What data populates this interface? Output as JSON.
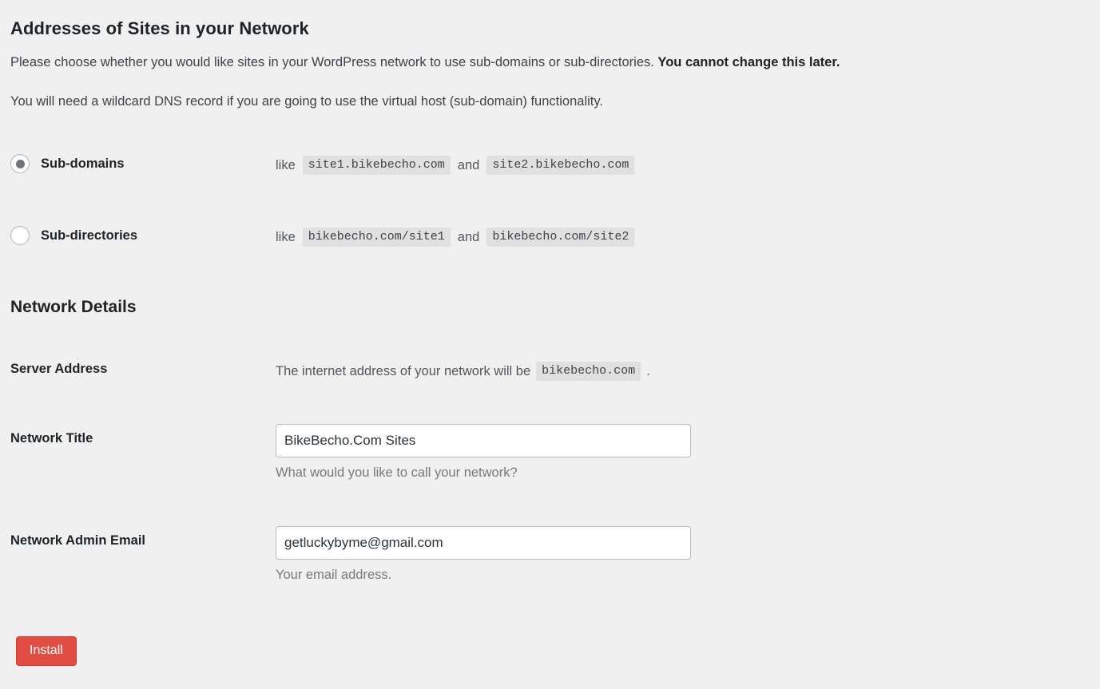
{
  "page": {
    "background_color": "#f0f0f1",
    "heading": "Addresses of Sites in your Network",
    "intro_paragraph_1_start": "Please choose whether you would like sites in your WordPress network to use sub-domains or sub-directories. ",
    "intro_paragraph_1_bold": "You cannot change this later.",
    "intro_paragraph_2": "You will need a wildcard DNS record if you are going to use the virtual host (sub-domain) functionality."
  },
  "address_options": {
    "like_label": "like",
    "and_label": "and",
    "options": [
      {
        "label": "Sub-domains",
        "selected": true,
        "example_1": "site1.bikebecho.com",
        "example_2": "site2.bikebecho.com"
      },
      {
        "label": "Sub-directories",
        "selected": false,
        "example_1": "bikebecho.com/site1",
        "example_2": "bikebecho.com/site2"
      }
    ]
  },
  "network_details": {
    "heading": "Network Details",
    "server_address": {
      "label": "Server Address",
      "text_before": "The internet address of your network will be",
      "value": "bikebecho.com",
      "text_after": "."
    },
    "network_title": {
      "label": "Network Title",
      "value": "BikeBecho.Com Sites",
      "placeholder": "",
      "description": "What would you like to call your network?"
    },
    "network_admin_email": {
      "label": "Network Admin Email",
      "value": "getluckybyme@gmail.com",
      "placeholder": "",
      "description": "Your email address."
    }
  },
  "actions": {
    "install_label": "Install",
    "install_color": "#e14d43"
  }
}
